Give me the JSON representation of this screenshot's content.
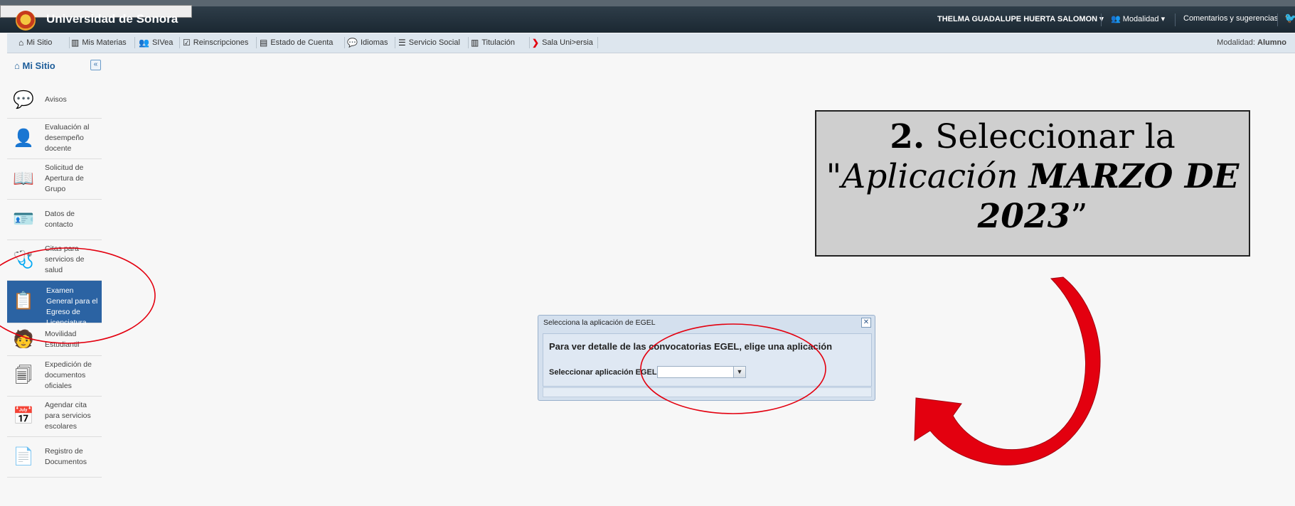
{
  "header": {
    "brand": "Universidad de Sonora",
    "user": "THELMA GUADALUPE HUERTA SALOMON",
    "modalidad_menu": "Modalidad",
    "comments_link": "Comentarios y sugerencias"
  },
  "navbar": {
    "items": [
      {
        "label": "Mi Sitio",
        "icon": "home-icon"
      },
      {
        "label": "Mis Materias",
        "icon": "books-icon"
      },
      {
        "label": "SIVea",
        "icon": "users-icon"
      },
      {
        "label": "Reinscripciones",
        "icon": "clipboard-check-icon"
      },
      {
        "label": "Estado de Cuenta",
        "icon": "money-icon"
      },
      {
        "label": "Idiomas",
        "icon": "chat-icon"
      },
      {
        "label": "Servicio Social",
        "icon": "list-check-icon"
      },
      {
        "label": "Titulación",
        "icon": "books-icon"
      },
      {
        "label": "Sala Uni>ersia",
        "icon": "universia-icon"
      }
    ],
    "modalidad_prefix": "Modalidad:",
    "modalidad_value": "Alumno"
  },
  "sidebar": {
    "title": "Mi Sitio",
    "items": [
      {
        "label": "Avisos",
        "icon": "speech-bubble-icon"
      },
      {
        "label": "Evaluación al desempeño docente",
        "icon": "teacher-icon"
      },
      {
        "label": "Solicitud de Apertura de Grupo",
        "icon": "open-book-icon"
      },
      {
        "label": "Datos de contacto",
        "icon": "contact-card-icon"
      },
      {
        "label": "Citas para servicios de salud",
        "icon": "doctor-icon"
      },
      {
        "label": "Examen General para el Egreso de Licenciatura",
        "icon": "clipboard-check-icon"
      },
      {
        "label": "Movilidad Estudiantil",
        "icon": "student-mobility-icon"
      },
      {
        "label": "Expedición de documentos oficiales",
        "icon": "documents-icon"
      },
      {
        "label": "Agendar cita para servicios escolares",
        "icon": "calendar-icon"
      },
      {
        "label": "Registro de Documentos",
        "icon": "register-document-icon"
      }
    ]
  },
  "dialog": {
    "title": "Selecciona la aplicación de EGEL",
    "heading": "Para ver detalle de las convocatorias EGEL, elige una aplicación",
    "select_label": "Seleccionar aplicación EGEL:",
    "select_value": ""
  },
  "callout": {
    "step": "2.",
    "line1": "Seleccionar la",
    "quote_open": "\"",
    "italic": "Aplicación",
    "bold_italic": "MARZO DE 2023",
    "quote_close": "”"
  },
  "colors": {
    "annotation_red": "#e3000f",
    "active_blue": "#2b63a3",
    "header_dark": "#1b2832"
  }
}
